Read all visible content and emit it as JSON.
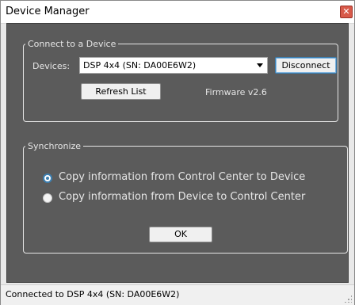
{
  "window": {
    "title": "Device Manager",
    "close_glyph": "✕"
  },
  "connect_group": {
    "title": "Connect to a Device",
    "devices_label": "Devices:",
    "device_selected": "DSP 4x4 (SN: DA00E6W2)",
    "disconnect_label": "Disconnect",
    "refresh_label": "Refresh List",
    "firmware_text": "Firmware v2.6"
  },
  "sync_group": {
    "title": "Synchronize",
    "options": [
      {
        "label": "Copy information from Control Center to Device",
        "checked": true
      },
      {
        "label": "Copy information from Device to Control Center",
        "checked": false
      }
    ],
    "ok_label": "OK"
  },
  "status": {
    "text": "Connected to DSP 4x4 (SN: DA00E6W2)"
  },
  "colors": {
    "panel_bg": "#5b5b5b",
    "radio_accent": "#3c7fb1",
    "close_bg": "#d85a4a"
  }
}
